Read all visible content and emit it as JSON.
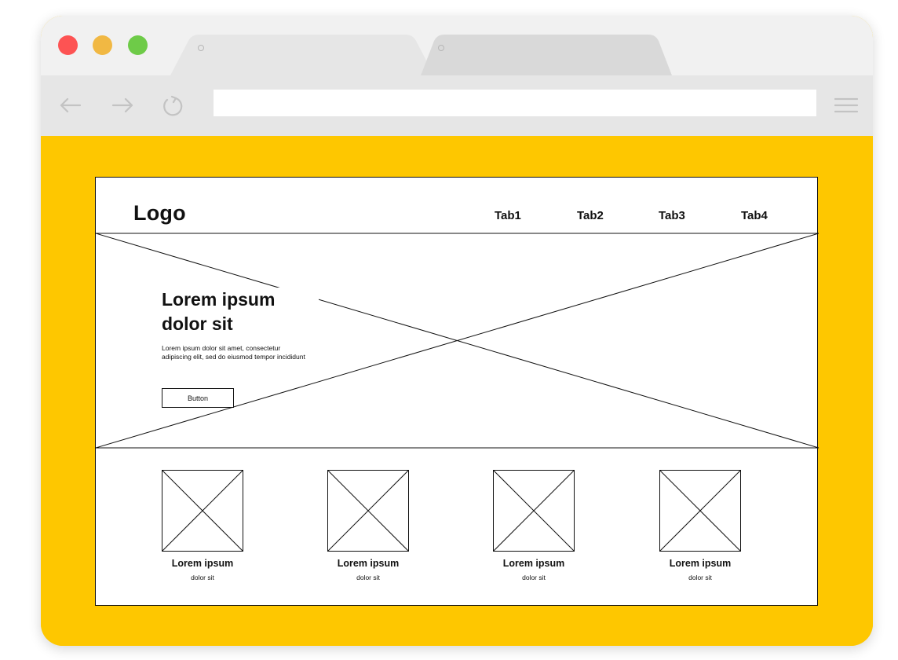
{
  "browser": {
    "tabs": [
      {
        "label": "",
        "active": true
      },
      {
        "label": "",
        "active": false
      }
    ],
    "address": {
      "value": ""
    },
    "colors": {
      "close": "#fd5353",
      "minimize": "#f1b843",
      "maximize": "#6ecb48",
      "page_background": "#fec700"
    }
  },
  "wireframe": {
    "logo": "Logo",
    "nav": [
      "Tab1",
      "Tab2",
      "Tab3",
      "Tab4"
    ],
    "hero": {
      "title_line1": "Lorem ipsum",
      "title_line2": "dolor sit",
      "body": "Lorem ipsum dolor sit amet, consectetur adipiscing elit, sed do eiusmod tempor incididunt",
      "button": "Button"
    },
    "cards": [
      {
        "title": "Lorem ipsum",
        "subtitle": "dolor sit"
      },
      {
        "title": "Lorem ipsum",
        "subtitle": "dolor sit"
      },
      {
        "title": "Lorem ipsum",
        "subtitle": "dolor sit"
      },
      {
        "title": "Lorem ipsum",
        "subtitle": "dolor sit"
      }
    ]
  }
}
